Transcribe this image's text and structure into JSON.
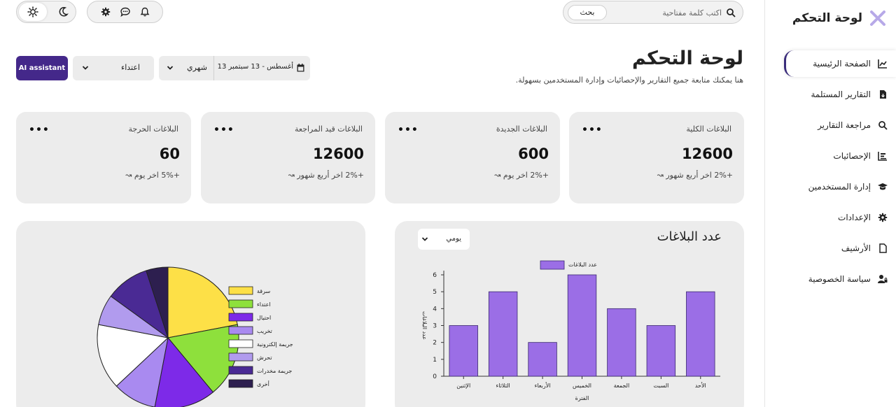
{
  "sidebar": {
    "brand_title": "لوحة التحكم",
    "items": [
      {
        "label": "الصفحة الرئيسية",
        "icon": "line-chart-icon",
        "active": true
      },
      {
        "label": "التقارير المستلمة",
        "icon": "file-download-icon",
        "active": false
      },
      {
        "label": "مراجعة التقارير",
        "icon": "search-icon",
        "active": false
      },
      {
        "label": "الإحصائيات",
        "icon": "bar-chart-icon",
        "active": false
      },
      {
        "label": "إدارة المستخدمين",
        "icon": "graduation-cap-icon",
        "active": false
      },
      {
        "label": "الإعدادات",
        "icon": "gear-icon",
        "active": false
      },
      {
        "label": "الأرشيف",
        "icon": "file-icon",
        "active": false
      },
      {
        "label": "سياسة الخصوصية",
        "icon": "user-lock-icon",
        "active": false
      }
    ]
  },
  "topbar": {
    "search_placeholder": "اكتب كلمة مفتاحية",
    "search_button": "بحث",
    "icons": [
      "gear-icon",
      "chat-icon",
      "bell-icon"
    ],
    "theme_icons": [
      "sun-icon",
      "moon-icon"
    ]
  },
  "header": {
    "title": "لوحة التحكم",
    "subtitle": "هنا يمكنك متابعة جميع التقارير والإحصائيات وإدارة المستخدمين بسهولة."
  },
  "controls": {
    "ai_button": "AI assistant",
    "type_select": "اعتداء",
    "period_select": "شهري",
    "date_range": "13 أغسطس - 13 سبتمبر"
  },
  "stats": [
    {
      "title": "البلاغات الكلية",
      "value": "12600",
      "note": "+2%  اخر أربع شهور"
    },
    {
      "title": "البلاغات الجديدة",
      "value": "600",
      "note": "+2%  اخر يوم"
    },
    {
      "title": "البلاغات قيد المراجعة",
      "value": "12600",
      "note": "+2%  اخر أربع شهور"
    },
    {
      "title": "البلاغات الحرجة",
      "value": "60",
      "note": "+5%  اخر يوم"
    }
  ],
  "bar_panel": {
    "title": "عدد البلاغات",
    "select_value": "يومي"
  },
  "colors": {
    "accent": "#44288a",
    "bar": "#9b6ee6",
    "card_bg": "#ececec"
  },
  "chart_data": [
    {
      "type": "bar",
      "categories": [
        "الإثنين",
        "الثلاثاء",
        "الأربعاء",
        "الخميس",
        "الجمعة",
        "السبت",
        "الأحد"
      ],
      "series": [
        {
          "name": "عدد البلاغات",
          "values": [
            3,
            5,
            2,
            6,
            4,
            3,
            5
          ],
          "color": "#9b6ee6"
        }
      ],
      "xlabel": "الفترة",
      "ylabel": "عدد البلاغات",
      "ylim": [
        0,
        6
      ],
      "yticks": [
        0,
        1,
        2,
        3,
        4,
        5,
        6
      ],
      "legend": "top-center",
      "grid": false
    },
    {
      "type": "pie",
      "labels": [
        "سرقة",
        "اعتداء",
        "احتيال",
        "تخريب",
        "جريمة إلكترونية",
        "تحرش",
        "جريمة مخدرات",
        "أخرى"
      ],
      "values": [
        22,
        17,
        14,
        10,
        15,
        7,
        10,
        5
      ],
      "colors": [
        "#fde047",
        "#8ee03c",
        "#7d2ae8",
        "#a98af0",
        "#ffffff",
        "#b19bee",
        "#4a2a94",
        "#2d1f4f"
      ],
      "legend": "right"
    }
  ]
}
